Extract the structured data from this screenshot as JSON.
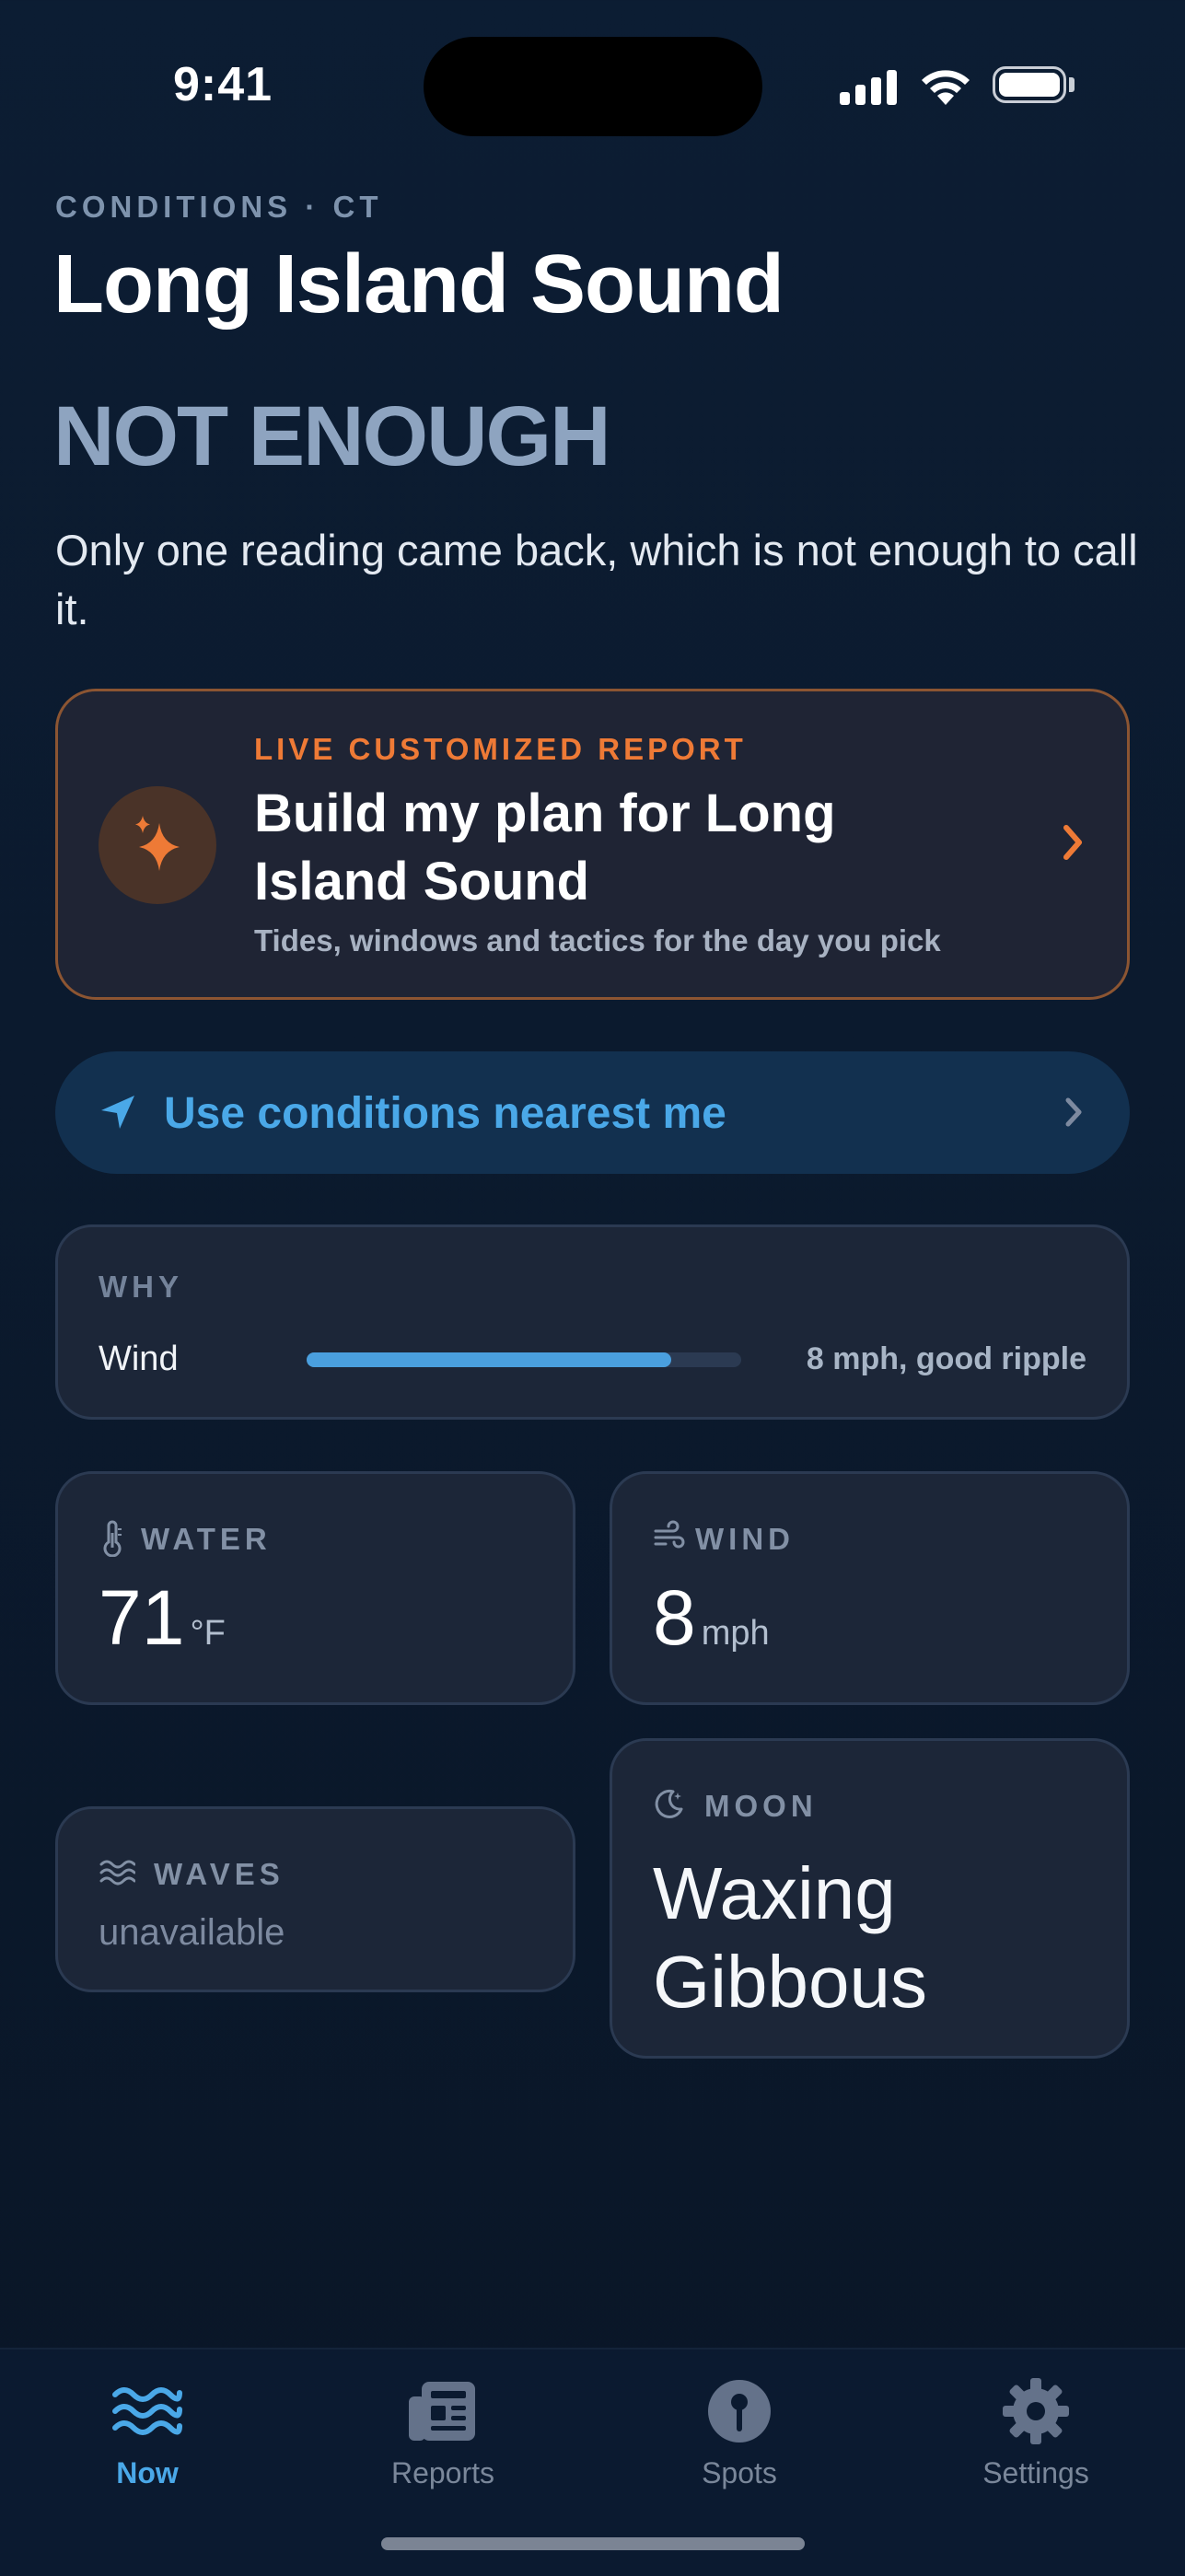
{
  "status_bar": {
    "time": "9:41"
  },
  "header": {
    "eyebrow": "CONDITIONS · CT",
    "title": "Long Island Sound",
    "verdict": "NOT ENOUGH",
    "explanation": "Only one reading came back, which is not enough to call it."
  },
  "report_card": {
    "eyebrow": "LIVE CUSTOMIZED REPORT",
    "title": "Build my plan for Long Island Sound",
    "subtitle": "Tides, windows and tactics for the day you pick",
    "icon": "sparkle-icon",
    "accent": "#ee7a36"
  },
  "location_button": {
    "label": "Use conditions nearest me",
    "icon": "location-arrow-icon"
  },
  "why": {
    "label": "WHY",
    "factor": "Wind",
    "value": "8 mph, good ripple",
    "level": 0.84
  },
  "stats": {
    "water": {
      "label": "WATER",
      "value": "71",
      "unit": "°F",
      "icon": "thermometer-icon"
    },
    "wind": {
      "label": "WIND",
      "value": "8",
      "unit": "mph",
      "icon": "wind-icon"
    },
    "waves": {
      "label": "WAVES",
      "value": "unavailable",
      "icon": "waves-icon"
    },
    "moon": {
      "label": "MOON",
      "value": "Waxing Gibbous",
      "icon": "moon-icon"
    }
  },
  "tabs": [
    {
      "label": "Now",
      "icon": "waves-icon",
      "active": true
    },
    {
      "label": "Reports",
      "icon": "newspaper-icon",
      "active": false
    },
    {
      "label": "Spots",
      "icon": "pin-icon",
      "active": false
    },
    {
      "label": "Settings",
      "icon": "gear-icon",
      "active": false
    }
  ],
  "colors": {
    "accent_blue": "#4aa8e8",
    "accent_orange": "#ee7a36",
    "background": "#0b1a2e"
  }
}
